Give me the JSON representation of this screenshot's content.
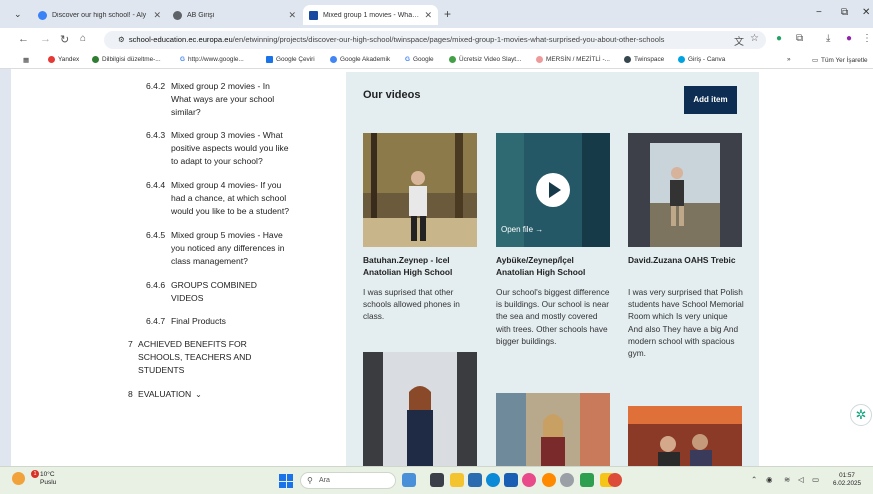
{
  "tabs": [
    {
      "title": "Discover our high school! - Aly",
      "favicon_color": "#3b82f6",
      "active": false
    },
    {
      "title": "AB Girişi",
      "favicon_color": "#5f6368",
      "active": false
    },
    {
      "title": "Mixed group 1 movies - What s",
      "favicon_color": "#1a4aa0",
      "active": true
    }
  ],
  "window": {
    "minimize": "−",
    "maximize": "⧉",
    "close": "✕",
    "new_tab": "+",
    "tab_menu": "⌄"
  },
  "address_bar": {
    "host": "school-education.ec.europa.eu",
    "path": "/en/etwinning/projects/discover-our-high-school/twinspace/pages/mixed-group-1-movies-what-surprised-you-about-other-schools"
  },
  "bookmarks": [
    {
      "label": "Yandex",
      "color": "#e53935"
    },
    {
      "label": "Dilbilgisi düzeltme-...",
      "color": "#2e7d32"
    },
    {
      "label": "http://www.google...",
      "color": "#4285f4"
    },
    {
      "label": "Google Çeviri",
      "color": "#1a73e8"
    },
    {
      "label": "Google Akademik",
      "color": "#4285f4"
    },
    {
      "label": "Google",
      "color": "#4285f4"
    },
    {
      "label": "Ücretsiz Video Slayt...",
      "color": "#43a047"
    },
    {
      "label": "MERSİN / MEZİTLİ -...",
      "color": "#ef9a9a"
    },
    {
      "label": "Twinspace",
      "color": "#37474f"
    },
    {
      "label": "Giriş - Canva",
      "color": "#00a3e0"
    }
  ],
  "bookmarks_more": "»",
  "bookmarks_all": "Tüm Yer İşaretle",
  "toc": [
    {
      "num": "6.4.2",
      "lines": [
        "Mixed group 2 movies - In",
        "What ways are your school",
        "similar?"
      ]
    },
    {
      "num": "6.4.3",
      "lines": [
        "Mixed group 3 movies - What",
        "positive aspects would you like",
        "to adapt to your school?"
      ]
    },
    {
      "num": "6.4.4",
      "lines": [
        "Mixed group 4 movies- If you",
        "had a chance, at which school",
        "would you like to be a student?"
      ]
    },
    {
      "num": "6.4.5",
      "lines": [
        "Mixed group 5 movies - Have",
        "you noticed any differences in",
        "class management?"
      ]
    },
    {
      "num": "6.4.6",
      "lines": [
        "GROUPS COMBINED",
        "VIDEOS"
      ]
    },
    {
      "num": "6.4.7",
      "lines": [
        "Final Products"
      ]
    },
    {
      "num": "7",
      "lines": [
        "ACHIEVED BENEFITS FOR",
        "SCHOOLS, TEACHERS AND",
        "STUDENTS"
      ]
    },
    {
      "num": "8",
      "lines": [
        "EVALUATION"
      ]
    }
  ],
  "videos": {
    "title": "Our videos",
    "add_label": "Add item",
    "open_file": "Open file →",
    "cards": [
      {
        "name": "Batuhan.Zeynep - Icel Anatolian High School",
        "desc": "I was suprised that other schools allowed phones in class."
      },
      {
        "name": "Aybüke/Zeynep/İçel Anatolian High School",
        "desc": "Our school's biggest difference is buildings. Our school is near the sea and mostly covered with trees. Other schools have bigger buildings."
      },
      {
        "name": "David.Zuzana OAHS Trebic",
        "desc": "I was very surprised that Polish students have School Memorial Room which Is very unique And also They have a big And modern school with spacious gym."
      }
    ]
  },
  "taskbar": {
    "temperature": "10°C",
    "weather": "Puslu",
    "weather_badge": "1",
    "search_placeholder": "Ara",
    "time": "01:57",
    "date": "6.02.2025"
  }
}
